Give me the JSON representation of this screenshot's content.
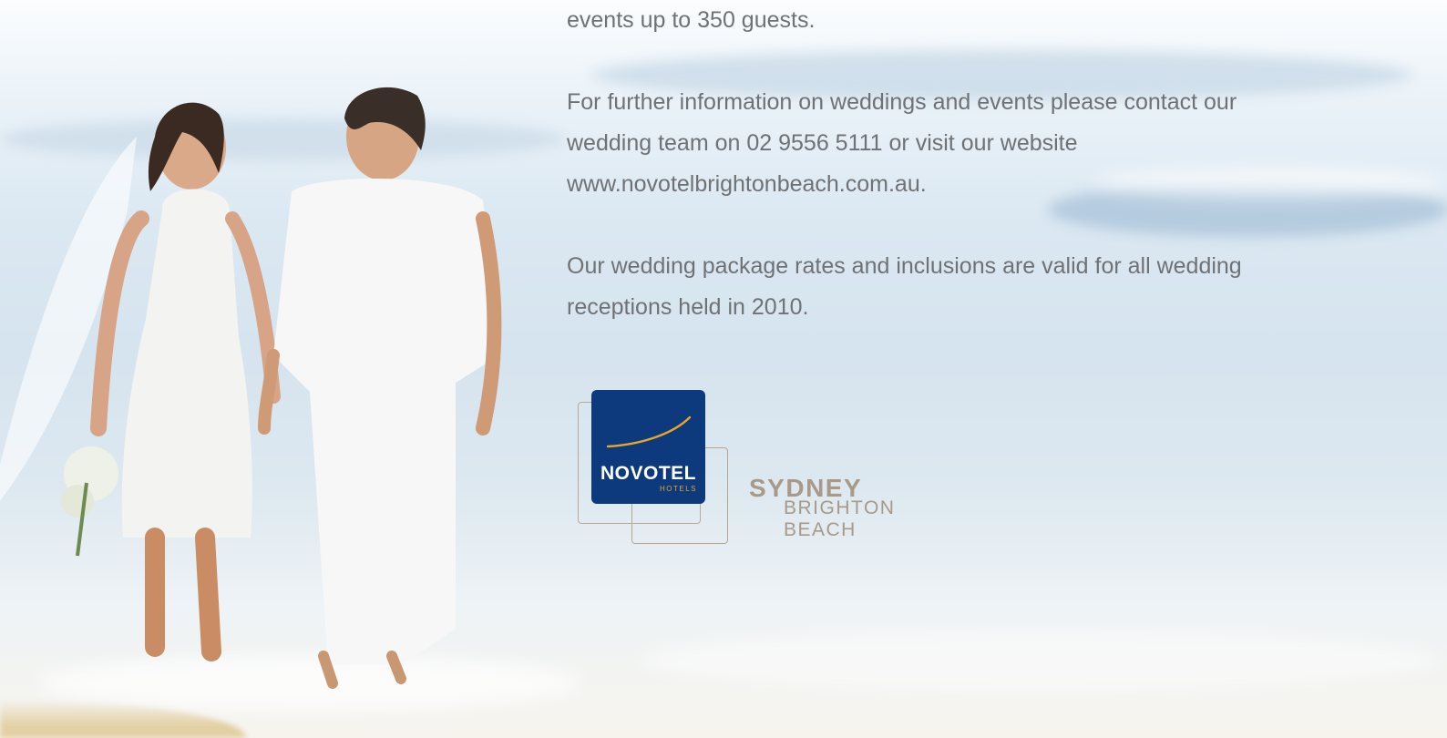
{
  "body": {
    "intro_tail": "events up to 350 guests.",
    "contact_paragraph_lines": [
      "For further information on weddings and events please contact our",
      "wedding team on 02 9556 5111 or visit our website",
      "www.novotelbrightonbeach.com.au."
    ],
    "validity_paragraph_lines": [
      "Our wedding package rates and inclusions are valid for all wedding",
      "receptions held in 2010."
    ]
  },
  "logo": {
    "brand": "NOVOTEL",
    "brand_sub": "HOTELS",
    "city": "SYDNEY",
    "location": "BRIGHTON BEACH"
  },
  "colors": {
    "body_text": "#6f7275",
    "logo_blue": "#0c3a7c",
    "logo_gold": "#e9a52a",
    "logo_caption": "#a89988"
  }
}
